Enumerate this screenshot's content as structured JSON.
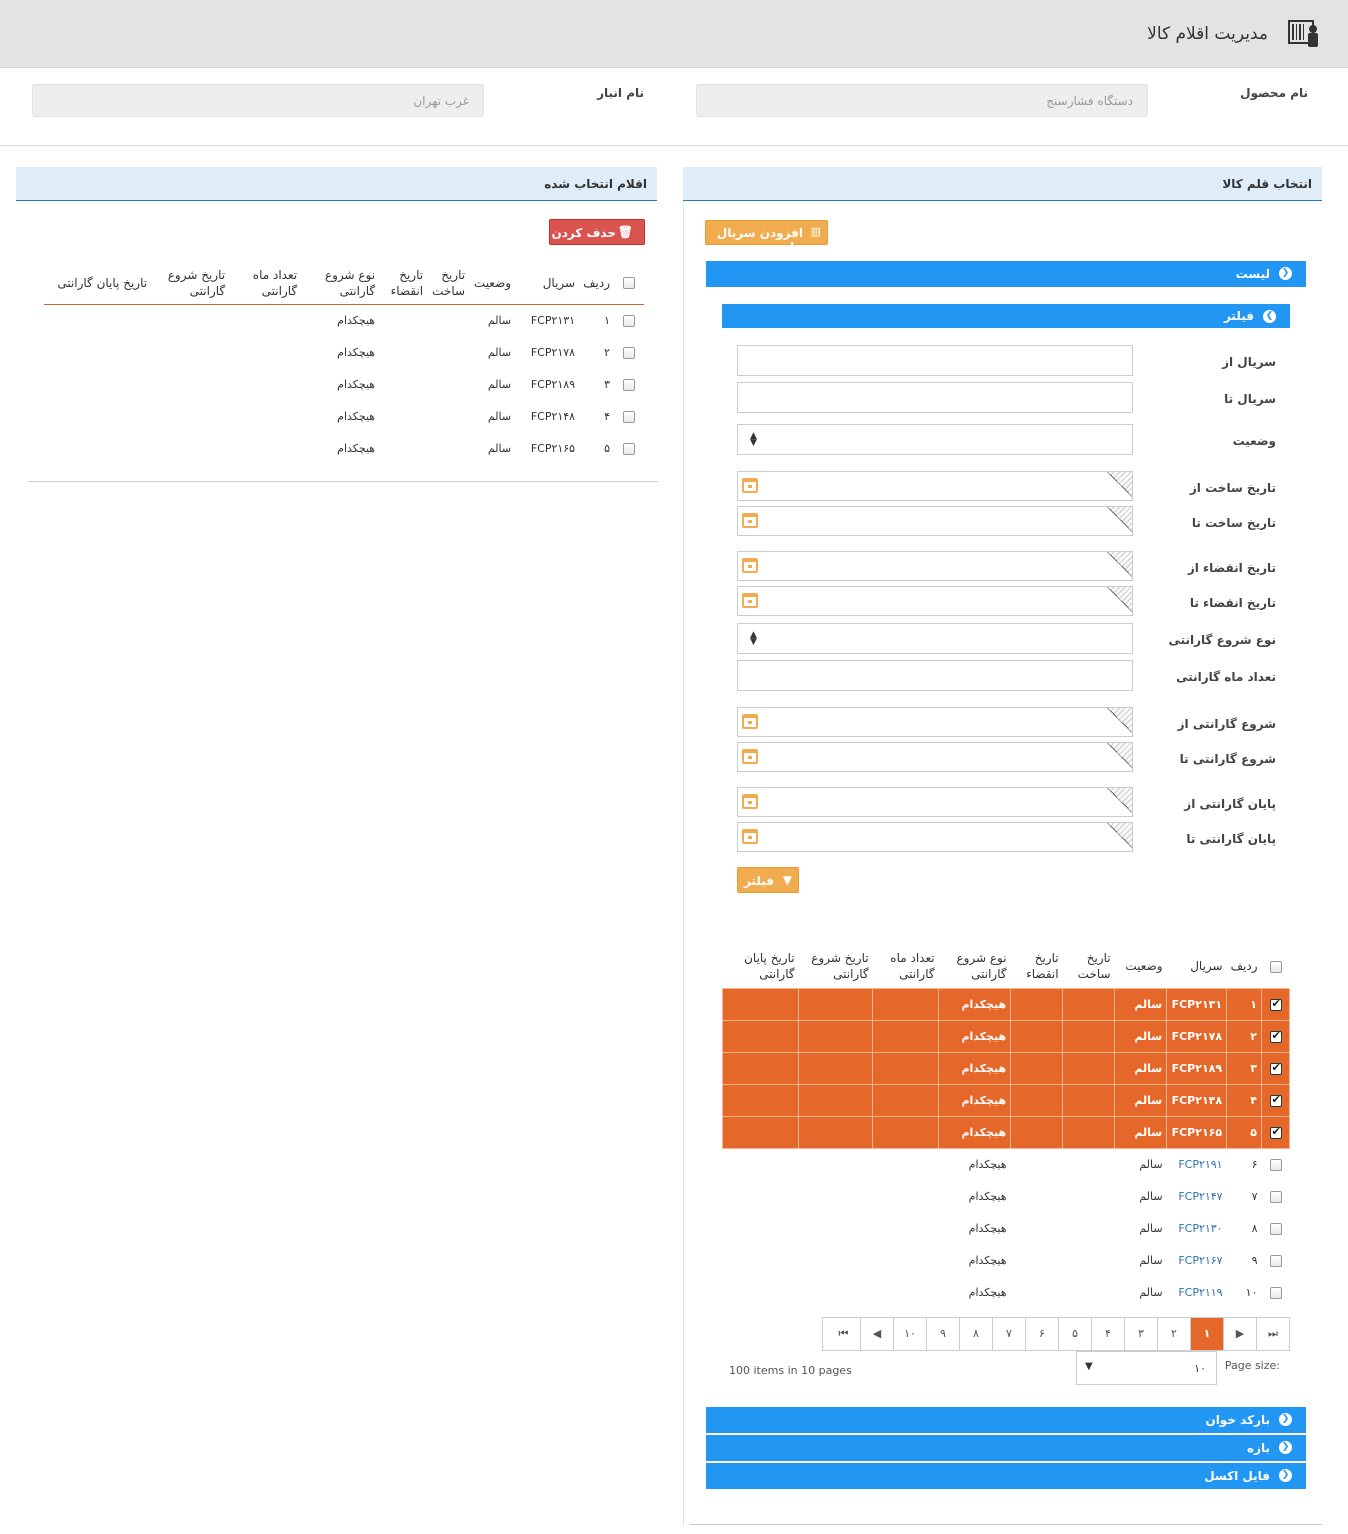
{
  "header": {
    "title": "مدیریت اقلام کالا",
    "icon": "barcode-scanner-icon"
  },
  "top": {
    "product_label": "نام محصول",
    "product_value": "دستگاه فشارسنج",
    "warehouse_label": "نام انبار",
    "warehouse_value": "غرب تهران"
  },
  "left_panel": {
    "title": "اقلام انتخاب شده",
    "delete_button": "حذف کردن",
    "columns": [
      "ردیف",
      "سریال",
      "وضعیت",
      "تاریخ ساخت",
      "تاریخ انقضاء",
      "نوع شروع گارانتی",
      "تعداد ماه گارانتی",
      "تاریخ شروع گارانتی",
      "تاریخ پایان گارانتی"
    ],
    "rows": [
      {
        "n": "۱",
        "serial": "FCP۲۱۳۱",
        "status": "سالم",
        "warranty_type": "هیچکدام"
      },
      {
        "n": "۲",
        "serial": "FCP۲۱۷۸",
        "status": "سالم",
        "warranty_type": "هیچکدام"
      },
      {
        "n": "۳",
        "serial": "FCP۲۱۸۹",
        "status": "سالم",
        "warranty_type": "هیچکدام"
      },
      {
        "n": "۴",
        "serial": "FCP۲۱۴۸",
        "status": "سالم",
        "warranty_type": "هیچکدام"
      },
      {
        "n": "۵",
        "serial": "FCP۲۱۶۵",
        "status": "سالم",
        "warranty_type": "هیچکدام"
      }
    ]
  },
  "right_panel": {
    "title": "انتخاب قلم کالا",
    "add_serials_button": "افزودن سریال ها",
    "list_label": "لیست",
    "filter_label": "فیلتر",
    "filter_button": "فیلتر",
    "fields": {
      "serial_from": "سریال از",
      "serial_to": "سریال تا",
      "status": "وضعیت",
      "build_from": "تاریخ ساخت از",
      "build_to": "تاریخ ساخت تا",
      "expire_from": "تاریخ انقضاء از",
      "expire_to": "تاریخ انقضاء تا",
      "warranty_type": "نوع شروع گارانتی",
      "warranty_months": "تعداد ماه گارانتی",
      "warranty_start_from": "شروع گارانتی از",
      "warranty_start_to": "شروع گارانتی تا",
      "warranty_end_from": "پایان گارانتی از",
      "warranty_end_to": "پایان گارانتی تا"
    },
    "columns": [
      "ردیف",
      "سریال",
      "وضعیت",
      "تاریخ ساخت",
      "تاریخ انقضاء",
      "نوع شروع گارانتی",
      "تعداد ماه گارانتی",
      "تاریخ شروع گارانتی",
      "تاریخ پایان گارانتی"
    ],
    "rows": [
      {
        "n": "۱",
        "serial": "FCP۲۱۳۱",
        "status": "سالم",
        "warranty_type": "هیچکدام",
        "checked": true
      },
      {
        "n": "۲",
        "serial": "FCP۲۱۷۸",
        "status": "سالم",
        "warranty_type": "هیچکدام",
        "checked": true
      },
      {
        "n": "۳",
        "serial": "FCP۲۱۸۹",
        "status": "سالم",
        "warranty_type": "هیچکدام",
        "checked": true
      },
      {
        "n": "۴",
        "serial": "FCP۲۱۴۸",
        "status": "سالم",
        "warranty_type": "هیچکدام",
        "checked": true
      },
      {
        "n": "۵",
        "serial": "FCP۲۱۶۵",
        "status": "سالم",
        "warranty_type": "هیچکدام",
        "checked": true
      },
      {
        "n": "۶",
        "serial": "FCP۲۱۹۱",
        "status": "سالم",
        "warranty_type": "هیچکدام",
        "checked": false
      },
      {
        "n": "۷",
        "serial": "FCP۲۱۴۷",
        "status": "سالم",
        "warranty_type": "هیچکدام",
        "checked": false
      },
      {
        "n": "۸",
        "serial": "FCP۲۱۳۰",
        "status": "سالم",
        "warranty_type": "هیچکدام",
        "checked": false
      },
      {
        "n": "۹",
        "serial": "FCP۲۱۶۷",
        "status": "سالم",
        "warranty_type": "هیچکدام",
        "checked": false
      },
      {
        "n": "۱۰",
        "serial": "FCP۲۱۱۹",
        "status": "سالم",
        "warranty_type": "هیچکدام",
        "checked": false
      }
    ],
    "pager": {
      "pages": [
        "۱",
        "۲",
        "۳",
        "۴",
        "۵",
        "۶",
        "۷",
        "۸",
        "۹",
        "۱۰"
      ],
      "active": "۱",
      "page_size_label": "Page size:",
      "page_size_value": "۱۰",
      "summary": "100 items in 10 pages"
    },
    "accordions": [
      "بارکد خوان",
      "بازه",
      "فایل اکسل"
    ]
  },
  "colors": {
    "accent_blue": "#2196f3",
    "selected_row": "#e5672a",
    "button_orange": "#f0ac4e",
    "button_red": "#d9534f"
  }
}
